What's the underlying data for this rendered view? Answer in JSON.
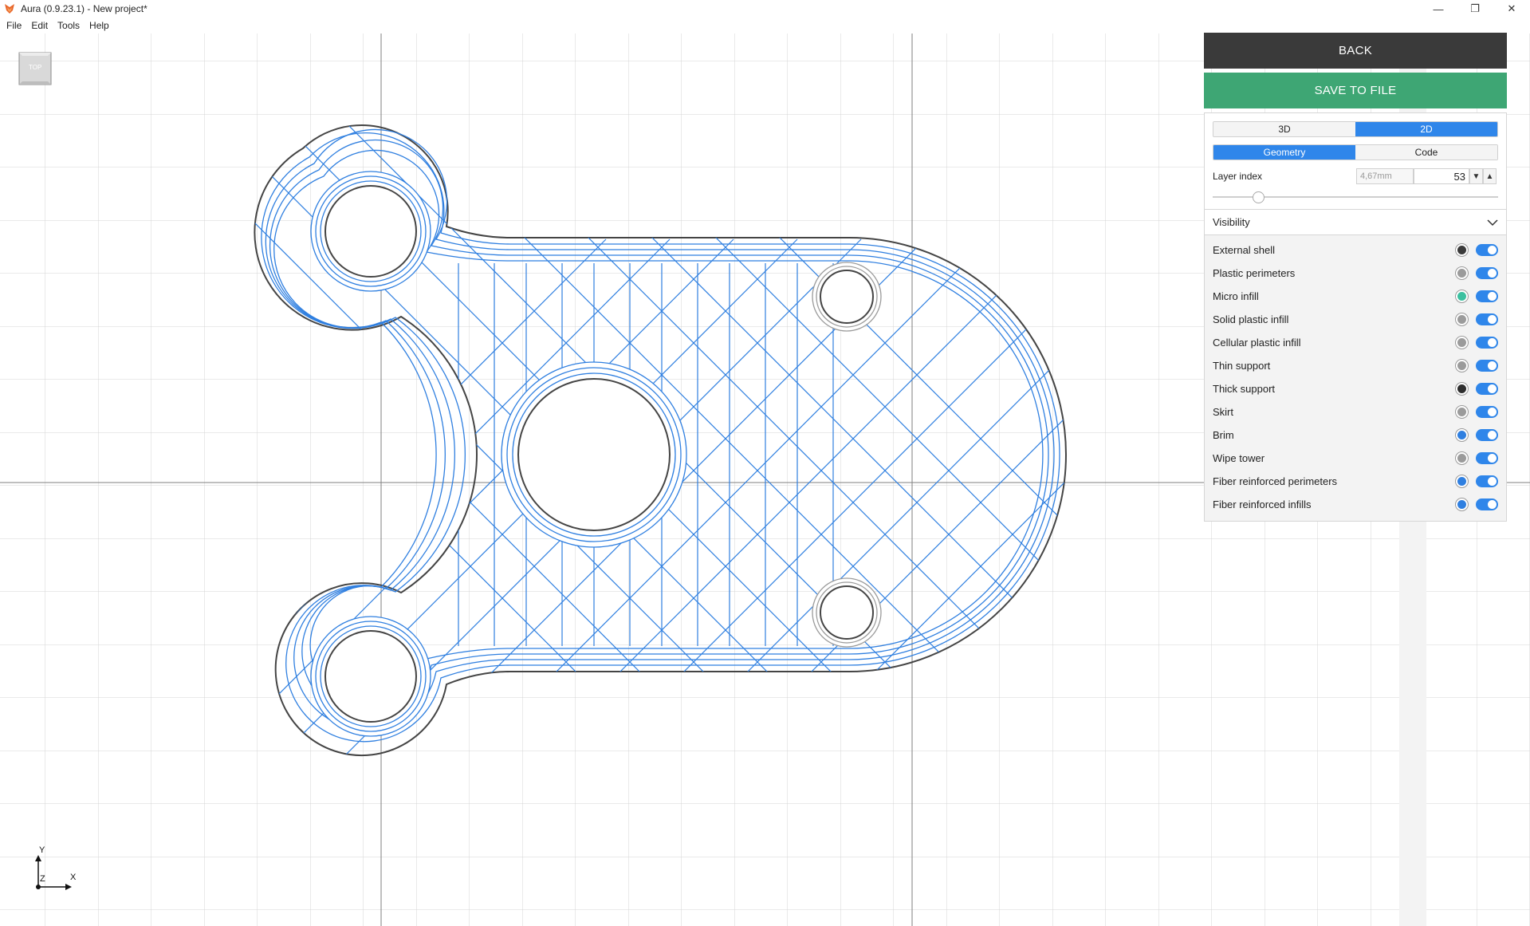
{
  "window": {
    "title": "Aura (0.9.23.1) - New project*",
    "controls": {
      "minimize": "—",
      "restore": "❐",
      "close": "✕"
    }
  },
  "menu": [
    "File",
    "Edit",
    "Tools",
    "Help"
  ],
  "viewport": {
    "view_cube_label": "TOP",
    "axes": {
      "x": "X",
      "y": "Y",
      "z": "Z"
    },
    "colors": {
      "perimeter": "#2f7fe0",
      "external_shell": "#444444",
      "thin": "#9a9a9a",
      "grid": "#d4d4d4",
      "grid_major": "#7f7f7f"
    }
  },
  "panel": {
    "back_label": "BACK",
    "save_label": "SAVE TO FILE",
    "view_modes": {
      "mode_3d": "3D",
      "mode_2d": "2D",
      "active": "2D"
    },
    "sub_modes": {
      "geometry": "Geometry",
      "code": "Code",
      "active": "Geometry"
    },
    "layer": {
      "label": "Layer index",
      "height": "4,67mm",
      "index": "53"
    },
    "visibility": {
      "header": "Visibility",
      "items": [
        {
          "label": "External shell",
          "color": "#3a3a3a",
          "enabled": true
        },
        {
          "label": "Plastic perimeters",
          "color": "#9b9b9b",
          "enabled": true
        },
        {
          "label": "Micro infill",
          "color": "#3cc0a0",
          "enabled": true
        },
        {
          "label": "Solid plastic infill",
          "color": "#9b9b9b",
          "enabled": true
        },
        {
          "label": "Cellular plastic infill",
          "color": "#9b9b9b",
          "enabled": true
        },
        {
          "label": "Thin support",
          "color": "#9b9b9b",
          "enabled": true
        },
        {
          "label": "Thick support",
          "color": "#2e2e2e",
          "enabled": true
        },
        {
          "label": "Skirt",
          "color": "#9b9b9b",
          "enabled": true
        },
        {
          "label": "Brim",
          "color": "#2f7fe0",
          "enabled": true
        },
        {
          "label": "Wipe tower",
          "color": "#9b9b9b",
          "enabled": true
        },
        {
          "label": "Fiber reinforced perimeters",
          "color": "#2f7fe0",
          "enabled": true
        },
        {
          "label": "Fiber reinforced infills",
          "color": "#2f7fe0",
          "enabled": true
        }
      ]
    }
  }
}
